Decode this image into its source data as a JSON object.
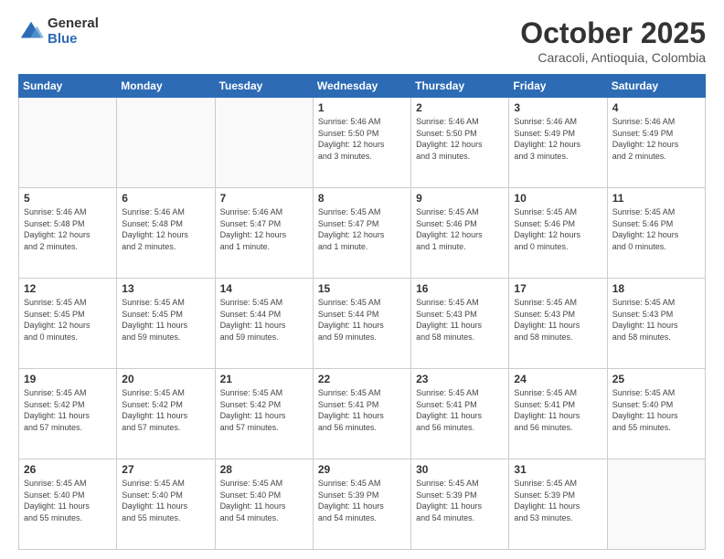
{
  "logo": {
    "general": "General",
    "blue": "Blue"
  },
  "title": "October 2025",
  "location": "Caracoli, Antioquia, Colombia",
  "days_of_week": [
    "Sunday",
    "Monday",
    "Tuesday",
    "Wednesday",
    "Thursday",
    "Friday",
    "Saturday"
  ],
  "weeks": [
    [
      {
        "day": "",
        "info": ""
      },
      {
        "day": "",
        "info": ""
      },
      {
        "day": "",
        "info": ""
      },
      {
        "day": "1",
        "info": "Sunrise: 5:46 AM\nSunset: 5:50 PM\nDaylight: 12 hours\nand 3 minutes."
      },
      {
        "day": "2",
        "info": "Sunrise: 5:46 AM\nSunset: 5:50 PM\nDaylight: 12 hours\nand 3 minutes."
      },
      {
        "day": "3",
        "info": "Sunrise: 5:46 AM\nSunset: 5:49 PM\nDaylight: 12 hours\nand 3 minutes."
      },
      {
        "day": "4",
        "info": "Sunrise: 5:46 AM\nSunset: 5:49 PM\nDaylight: 12 hours\nand 2 minutes."
      }
    ],
    [
      {
        "day": "5",
        "info": "Sunrise: 5:46 AM\nSunset: 5:48 PM\nDaylight: 12 hours\nand 2 minutes."
      },
      {
        "day": "6",
        "info": "Sunrise: 5:46 AM\nSunset: 5:48 PM\nDaylight: 12 hours\nand 2 minutes."
      },
      {
        "day": "7",
        "info": "Sunrise: 5:46 AM\nSunset: 5:47 PM\nDaylight: 12 hours\nand 1 minute."
      },
      {
        "day": "8",
        "info": "Sunrise: 5:45 AM\nSunset: 5:47 PM\nDaylight: 12 hours\nand 1 minute."
      },
      {
        "day": "9",
        "info": "Sunrise: 5:45 AM\nSunset: 5:46 PM\nDaylight: 12 hours\nand 1 minute."
      },
      {
        "day": "10",
        "info": "Sunrise: 5:45 AM\nSunset: 5:46 PM\nDaylight: 12 hours\nand 0 minutes."
      },
      {
        "day": "11",
        "info": "Sunrise: 5:45 AM\nSunset: 5:46 PM\nDaylight: 12 hours\nand 0 minutes."
      }
    ],
    [
      {
        "day": "12",
        "info": "Sunrise: 5:45 AM\nSunset: 5:45 PM\nDaylight: 12 hours\nand 0 minutes."
      },
      {
        "day": "13",
        "info": "Sunrise: 5:45 AM\nSunset: 5:45 PM\nDaylight: 11 hours\nand 59 minutes."
      },
      {
        "day": "14",
        "info": "Sunrise: 5:45 AM\nSunset: 5:44 PM\nDaylight: 11 hours\nand 59 minutes."
      },
      {
        "day": "15",
        "info": "Sunrise: 5:45 AM\nSunset: 5:44 PM\nDaylight: 11 hours\nand 59 minutes."
      },
      {
        "day": "16",
        "info": "Sunrise: 5:45 AM\nSunset: 5:43 PM\nDaylight: 11 hours\nand 58 minutes."
      },
      {
        "day": "17",
        "info": "Sunrise: 5:45 AM\nSunset: 5:43 PM\nDaylight: 11 hours\nand 58 minutes."
      },
      {
        "day": "18",
        "info": "Sunrise: 5:45 AM\nSunset: 5:43 PM\nDaylight: 11 hours\nand 58 minutes."
      }
    ],
    [
      {
        "day": "19",
        "info": "Sunrise: 5:45 AM\nSunset: 5:42 PM\nDaylight: 11 hours\nand 57 minutes."
      },
      {
        "day": "20",
        "info": "Sunrise: 5:45 AM\nSunset: 5:42 PM\nDaylight: 11 hours\nand 57 minutes."
      },
      {
        "day": "21",
        "info": "Sunrise: 5:45 AM\nSunset: 5:42 PM\nDaylight: 11 hours\nand 57 minutes."
      },
      {
        "day": "22",
        "info": "Sunrise: 5:45 AM\nSunset: 5:41 PM\nDaylight: 11 hours\nand 56 minutes."
      },
      {
        "day": "23",
        "info": "Sunrise: 5:45 AM\nSunset: 5:41 PM\nDaylight: 11 hours\nand 56 minutes."
      },
      {
        "day": "24",
        "info": "Sunrise: 5:45 AM\nSunset: 5:41 PM\nDaylight: 11 hours\nand 56 minutes."
      },
      {
        "day": "25",
        "info": "Sunrise: 5:45 AM\nSunset: 5:40 PM\nDaylight: 11 hours\nand 55 minutes."
      }
    ],
    [
      {
        "day": "26",
        "info": "Sunrise: 5:45 AM\nSunset: 5:40 PM\nDaylight: 11 hours\nand 55 minutes."
      },
      {
        "day": "27",
        "info": "Sunrise: 5:45 AM\nSunset: 5:40 PM\nDaylight: 11 hours\nand 55 minutes."
      },
      {
        "day": "28",
        "info": "Sunrise: 5:45 AM\nSunset: 5:40 PM\nDaylight: 11 hours\nand 54 minutes."
      },
      {
        "day": "29",
        "info": "Sunrise: 5:45 AM\nSunset: 5:39 PM\nDaylight: 11 hours\nand 54 minutes."
      },
      {
        "day": "30",
        "info": "Sunrise: 5:45 AM\nSunset: 5:39 PM\nDaylight: 11 hours\nand 54 minutes."
      },
      {
        "day": "31",
        "info": "Sunrise: 5:45 AM\nSunset: 5:39 PM\nDaylight: 11 hours\nand 53 minutes."
      },
      {
        "day": "",
        "info": ""
      }
    ]
  ]
}
